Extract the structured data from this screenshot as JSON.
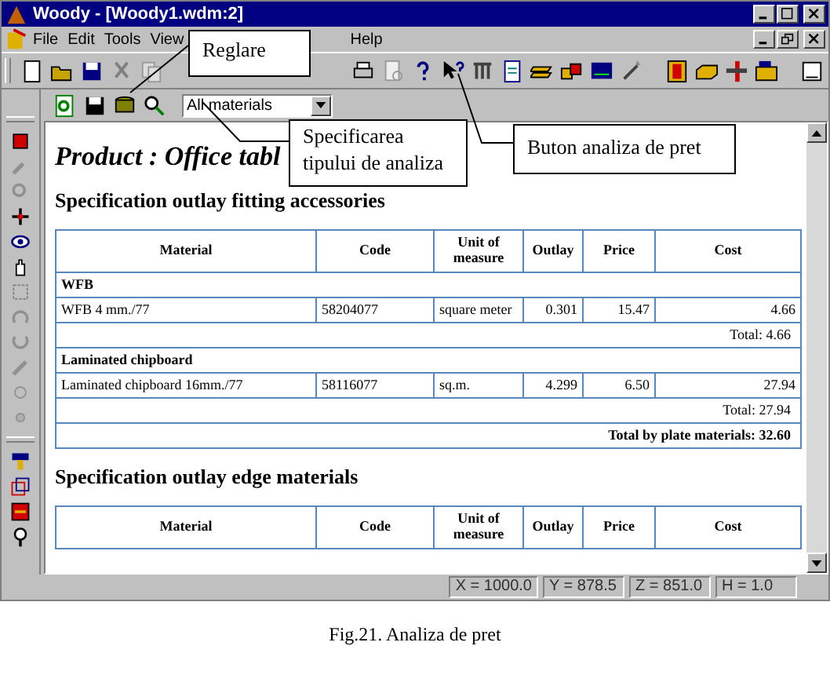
{
  "window": {
    "title": "Woody - [Woody1.wdm:2]"
  },
  "menu": {
    "items": [
      "File",
      "Edit",
      "Tools",
      "View"
    ],
    "items_right": [
      "Help"
    ]
  },
  "analysis_type": {
    "value": "All materials"
  },
  "document": {
    "heading": "Product : Office tabl",
    "sections": [
      {
        "title": "Specification outlay fitting accessories",
        "columns": [
          "Material",
          "Code",
          "Unit of measure",
          "Outlay",
          "Price",
          "Cost"
        ],
        "groups": [
          {
            "name": "WFB",
            "rows": [
              [
                "WFB 4 mm./77",
                "58204077",
                "square meter",
                "0.301",
                "15.47",
                "4.66"
              ]
            ],
            "total": "Total: 4.66"
          },
          {
            "name": "Laminated chipboard",
            "rows": [
              [
                "Laminated chipboard 16mm./77",
                "58116077",
                "sq.m.",
                "4.299",
                "6.50",
                "27.94"
              ]
            ],
            "total": "Total: 27.94"
          }
        ],
        "grand_total": "Total by plate materials: 32.60"
      },
      {
        "title": "Specification outlay edge materials",
        "columns": [
          "Material",
          "Code",
          "Unit of measure",
          "Outlay",
          "Price",
          "Cost"
        ]
      }
    ]
  },
  "status_bar": [
    "X = 1000.0",
    "Y = 878.5",
    "Z = 851.0",
    "H = 1.0"
  ],
  "callouts": [
    {
      "text": "Reglare"
    },
    {
      "text": "Specificarea tipului de analiza"
    },
    {
      "text": "Buton analiza de pret"
    }
  ],
  "caption": "Fig.21. Analiza de pret"
}
